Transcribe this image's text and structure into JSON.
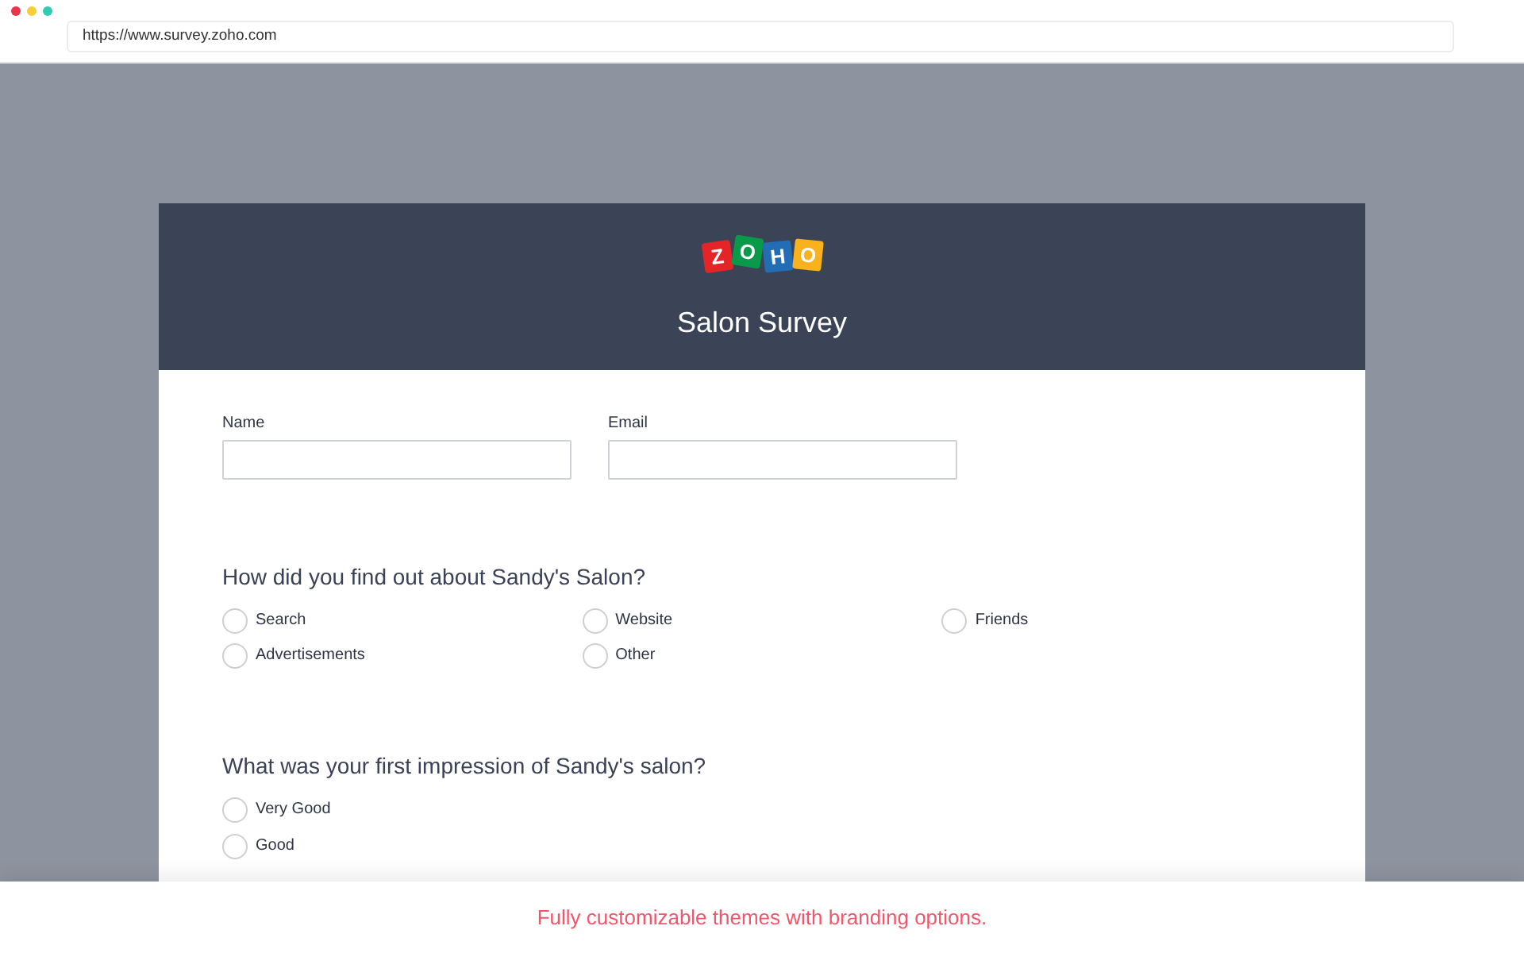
{
  "browser": {
    "url": "https://www.survey.zoho.com"
  },
  "header": {
    "logo": {
      "tiles": [
        {
          "letter": "Z",
          "color": "#e42527"
        },
        {
          "letter": "O",
          "color": "#089949"
        },
        {
          "letter": "H",
          "color": "#226db4"
        },
        {
          "letter": "O",
          "color": "#f9b21d"
        }
      ]
    },
    "title": "Salon Survey"
  },
  "fields": [
    {
      "label": "Name"
    },
    {
      "label": "Email"
    }
  ],
  "questions": [
    {
      "text": "How did you find out about Sandy's Salon?",
      "kind": "grid",
      "options": [
        {
          "label": "Search",
          "selected": false
        },
        {
          "label": "Website",
          "selected": false
        },
        {
          "label": "Friends",
          "selected": false
        },
        {
          "label": "Advertisements",
          "selected": false
        },
        {
          "label": "Other",
          "selected": false
        }
      ]
    },
    {
      "text": "What was your first impression of Sandy's salon?",
      "kind": "list",
      "options": [
        {
          "label": "Very Good",
          "selected": false
        },
        {
          "label": "Good",
          "selected": false
        }
      ]
    }
  ],
  "caption": "Fully customizable themes with branding options."
}
